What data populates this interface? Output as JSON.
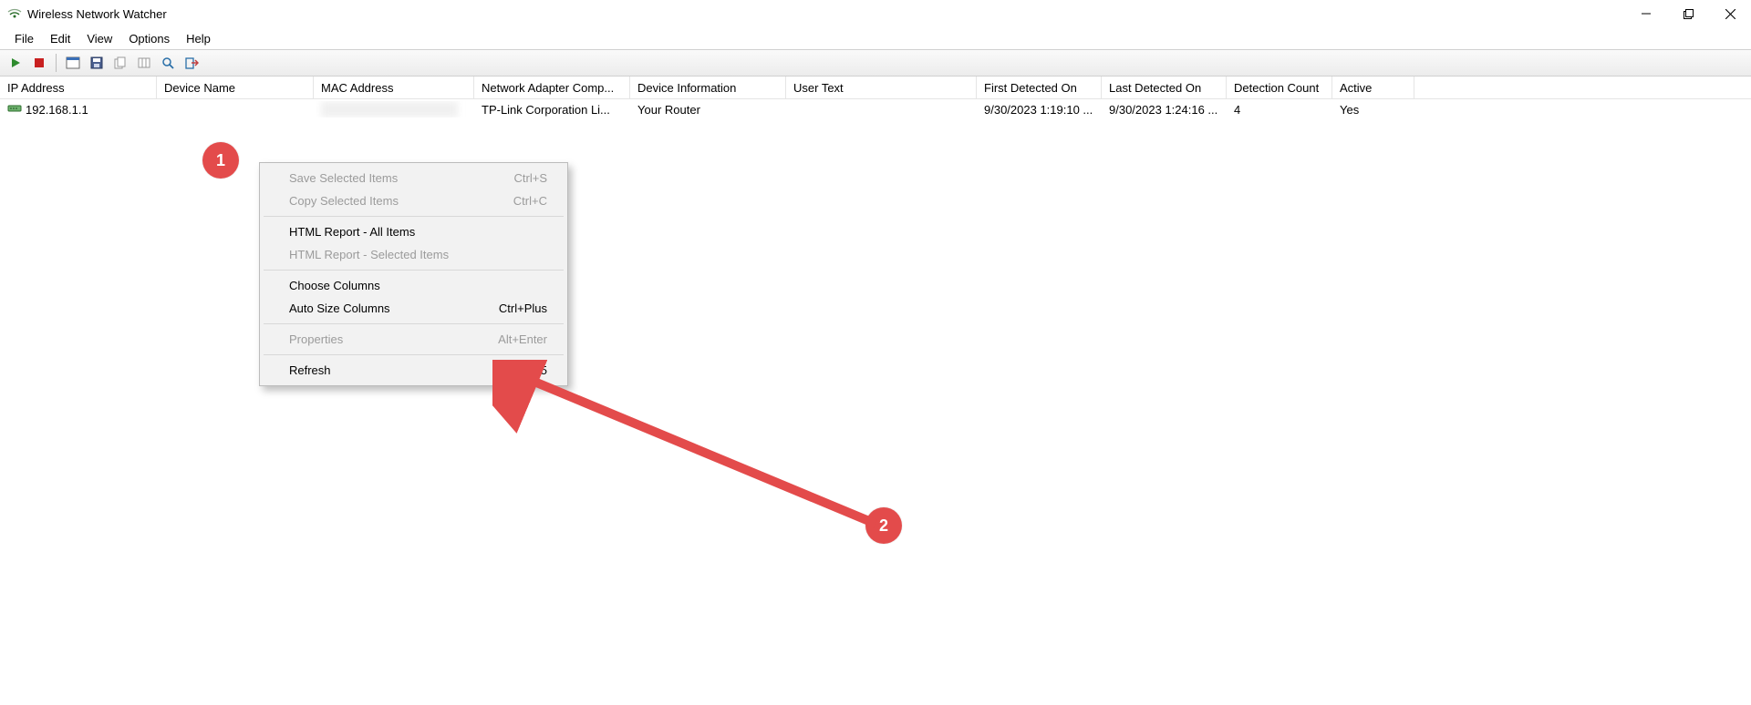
{
  "titlebar": {
    "title": "Wireless Network Watcher"
  },
  "menu": {
    "file": "File",
    "edit": "Edit",
    "view": "View",
    "options": "Options",
    "help": "Help"
  },
  "headers": {
    "ip": "IP Address",
    "device": "Device Name",
    "mac": "MAC Address",
    "company": "Network Adapter Comp...",
    "info": "Device Information",
    "user": "User Text",
    "first": "First Detected On",
    "last": "Last Detected On",
    "count": "Detection Count",
    "active": "Active"
  },
  "row": {
    "ip": "192.168.1.1",
    "device": "",
    "mac": "",
    "company": "TP-Link Corporation Li...",
    "info": "Your Router",
    "user": "",
    "first": "9/30/2023 1:19:10 ...",
    "last": "9/30/2023 1:24:16 ...",
    "count": "4",
    "active": "Yes"
  },
  "context": {
    "save": {
      "label": "Save Selected Items",
      "key": "Ctrl+S"
    },
    "copy": {
      "label": "Copy Selected Items",
      "key": "Ctrl+C"
    },
    "html_all": {
      "label": "HTML Report - All Items",
      "key": ""
    },
    "html_sel": {
      "label": "HTML Report - Selected Items",
      "key": ""
    },
    "choose": {
      "label": "Choose Columns",
      "key": ""
    },
    "autosize": {
      "label": "Auto Size Columns",
      "key": "Ctrl+Plus"
    },
    "props": {
      "label": "Properties",
      "key": "Alt+Enter"
    },
    "refresh": {
      "label": "Refresh",
      "key": "F5"
    }
  },
  "annotation": {
    "badge1": "1",
    "badge2": "2"
  }
}
